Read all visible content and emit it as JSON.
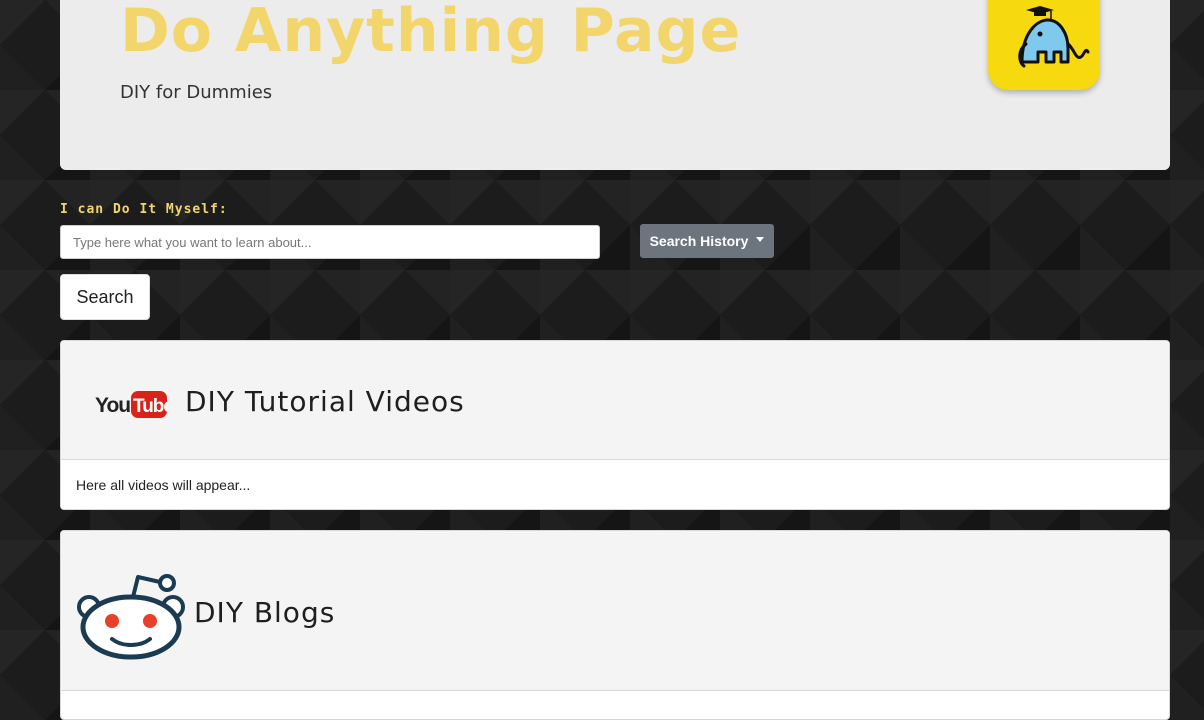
{
  "header": {
    "title": "Do Anything Page",
    "subtitle": "DIY for Dummies",
    "logo_icon": "elephant-graduate-icon",
    "title_color": "#f2d56b",
    "logo_background": "#f6d90f"
  },
  "search_form": {
    "label": "I can Do It Myself:",
    "input_placeholder": "Type here what you want to learn about...",
    "input_value": "",
    "search_button_label": "Search",
    "history_button_label": "Search History"
  },
  "videos_card": {
    "icon": "youtube-logo-icon",
    "title": "DIY Tutorial Videos",
    "body_text": "Here all videos will appear..."
  },
  "blogs_card": {
    "icon": "reddit-logo-icon",
    "title": "DIY Blogs"
  }
}
